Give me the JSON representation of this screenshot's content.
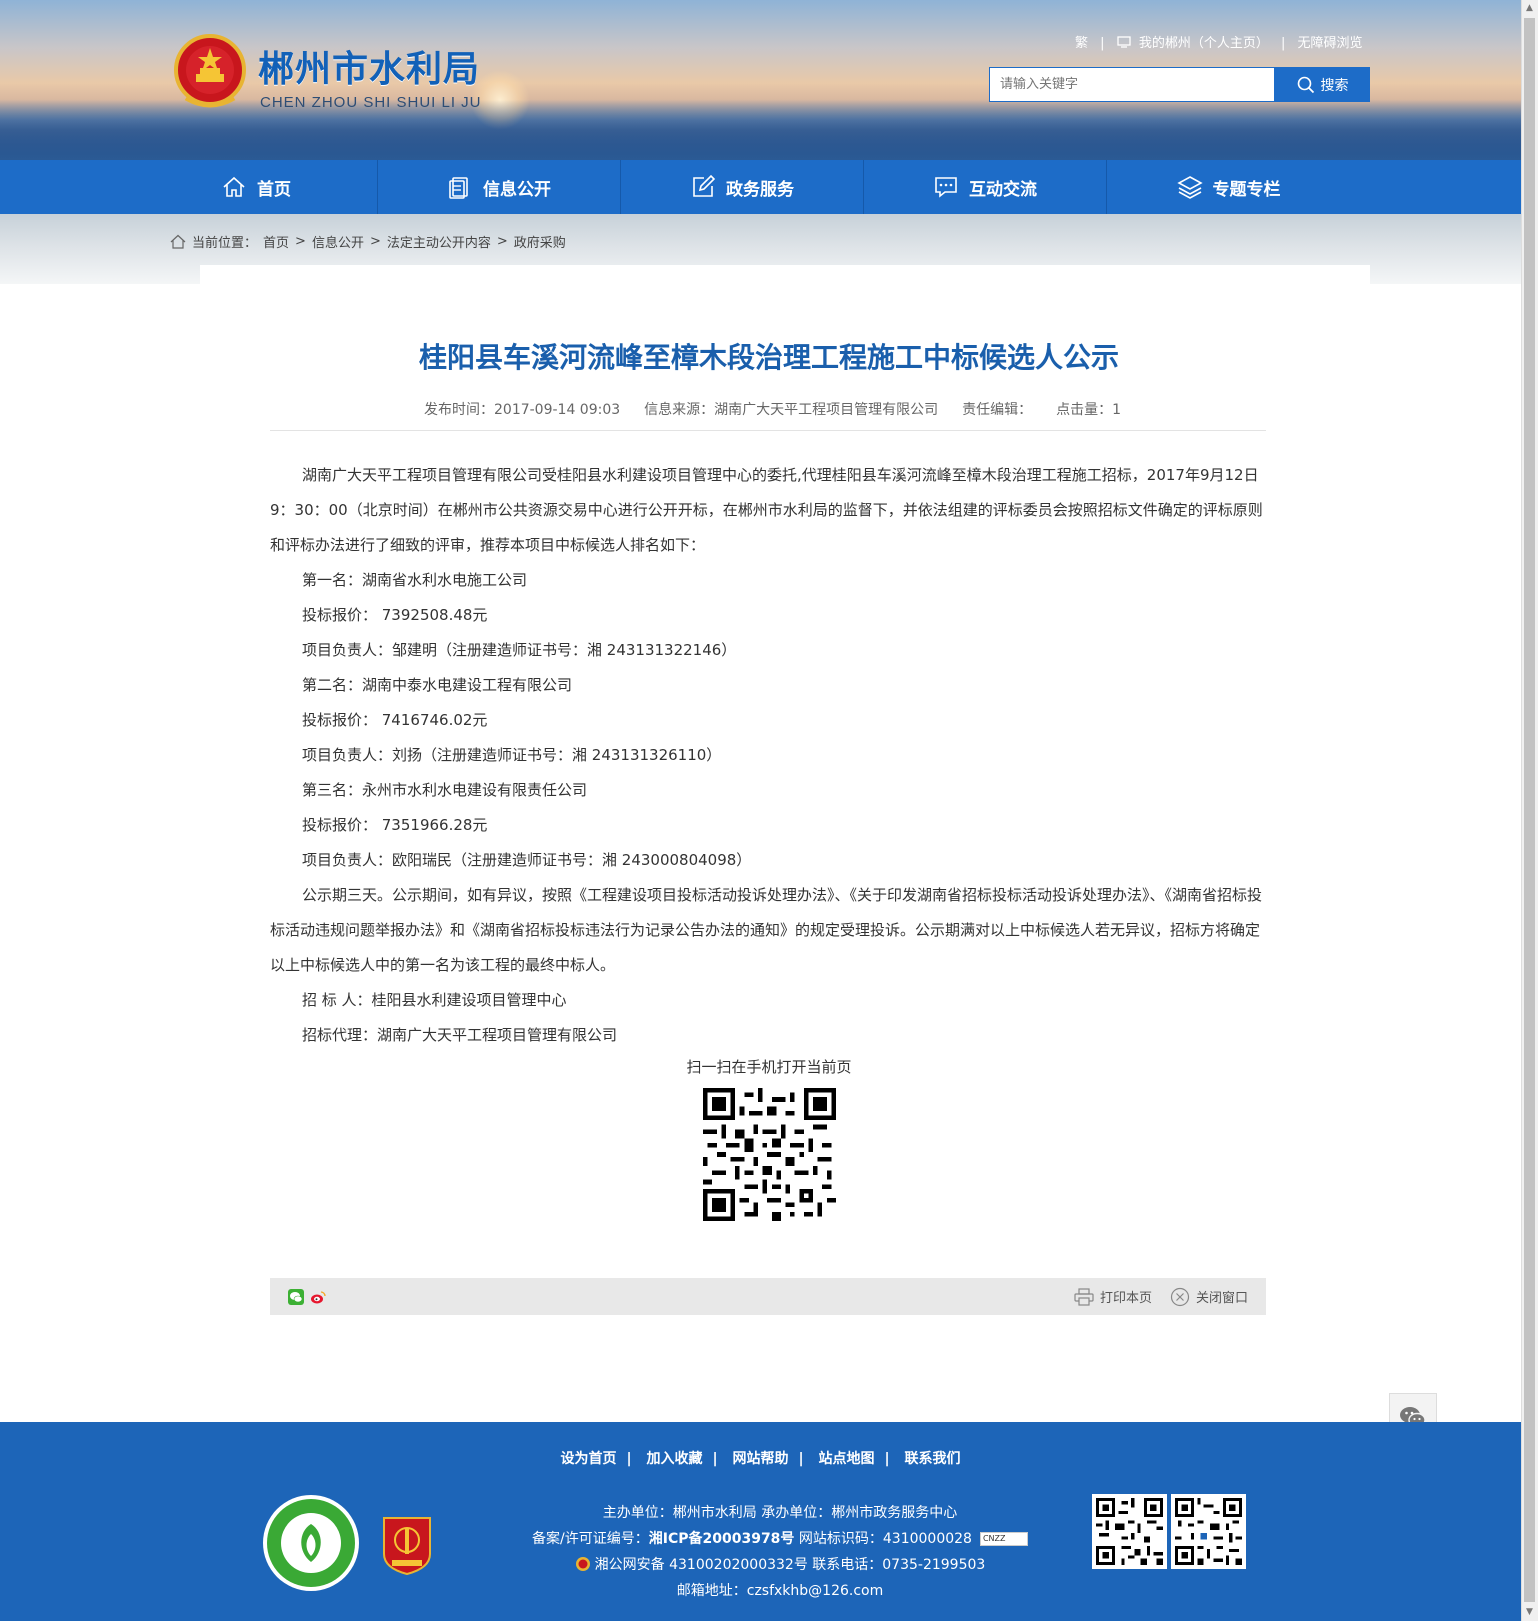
{
  "header": {
    "logo_cn": "郴州市水利局",
    "logo_en": "CHEN ZHOU SHI SHUI LI JU",
    "toplinks": {
      "traditional": "繁",
      "my_chenzhou": "我的郴州（个人主页）",
      "accessible": "无障碍浏览"
    },
    "search": {
      "placeholder": "请输入关键字",
      "button": "搜索"
    }
  },
  "nav": {
    "items": [
      {
        "label": "首页",
        "icon": "home-icon"
      },
      {
        "label": "信息公开",
        "icon": "document-icon"
      },
      {
        "label": "政务服务",
        "icon": "edit-icon"
      },
      {
        "label": "互动交流",
        "icon": "chat-icon"
      },
      {
        "label": "专题专栏",
        "icon": "layers-icon"
      }
    ]
  },
  "breadcrumb": {
    "prefix": "当前位置：",
    "items": [
      "首页",
      "信息公开",
      "法定主动公开内容",
      "政府采购"
    ],
    "separator": ">"
  },
  "article": {
    "title": "桂阳县车溪河流峰至樟木段治理工程施工中标候选人公示",
    "meta": {
      "publish": "发布时间：2017-09-14 09:03",
      "source": "信息来源：湖南广大天平工程项目管理有限公司",
      "editor": "责任编辑：",
      "hits": "点击量：1"
    },
    "paragraphs": [
      "湖南广大天平工程项目管理有限公司受桂阳县水利建设项目管理中心的委托,代理桂阳县车溪河流峰至樟木段治理工程施工招标，2017年9月12日 9：30：00（北京时间）在郴州市公共资源交易中心进行公开开标，在郴州市水利局的监督下，并依法组建的评标委员会按照招标文件确定的评标原则和评标办法进行了细致的评审，推荐本项目中标候选人排名如下：",
      "第一名：湖南省水利水电施工公司",
      "投标报价： 7392508.48元",
      "项目负责人：邹建明（注册建造师证书号：湘 243131322146）",
      "第二名：湖南中泰水电建设工程有限公司",
      "投标报价： 7416746.02元",
      "项目负责人：刘扬（注册建造师证书号：湘 243131326110）",
      "第三名：永州市水利水电建设有限责任公司",
      "投标报价： 7351966.28元",
      "项目负责人：欧阳瑞民（注册建造师证书号：湘 243000804098）",
      "公示期三天。公示期间，如有异议，按照《工程建设项目投标活动投诉处理办法》、《关于印发湖南省招标投标活动投诉处理办法》、《湖南省招标投标活动违规问题举报办法》和《湖南省招标投标违法行为记录公告办法的通知》的规定受理投诉。公示期满对以上中标候选人若无异议，招标方将确定以上中标候选人中的第一名为该工程的最终中标人。",
      "招 标 人：桂阳县水利建设项目管理中心",
      "招标代理：湖南广大天平工程项目管理有限公司"
    ],
    "qr_label": "扫一扫在手机打开当前页"
  },
  "sharebar": {
    "print": "打印本页",
    "close": "关闭窗口"
  },
  "footer": {
    "links": [
      "设为首页",
      "加入收藏",
      "网站帮助",
      "站点地图",
      "联系我们"
    ],
    "line1": "主办单位：郴州市水利局   承办单位：郴州市政务服务中心",
    "line2_prefix": "备案/许可证编号：",
    "line2_icp": "湘ICP备20003978号",
    "line2_suffix": "   网站标识码：4310000028",
    "line3": "湘公网安备 43100202000332号   联系电话：0735-2199503",
    "line4": "邮箱地址：czsfxkhb@126.com",
    "cnzz": "CNZZ"
  },
  "colors": {
    "primary": "#1d6cc8",
    "title": "#1a5fac",
    "footer": "#1d65b8"
  }
}
